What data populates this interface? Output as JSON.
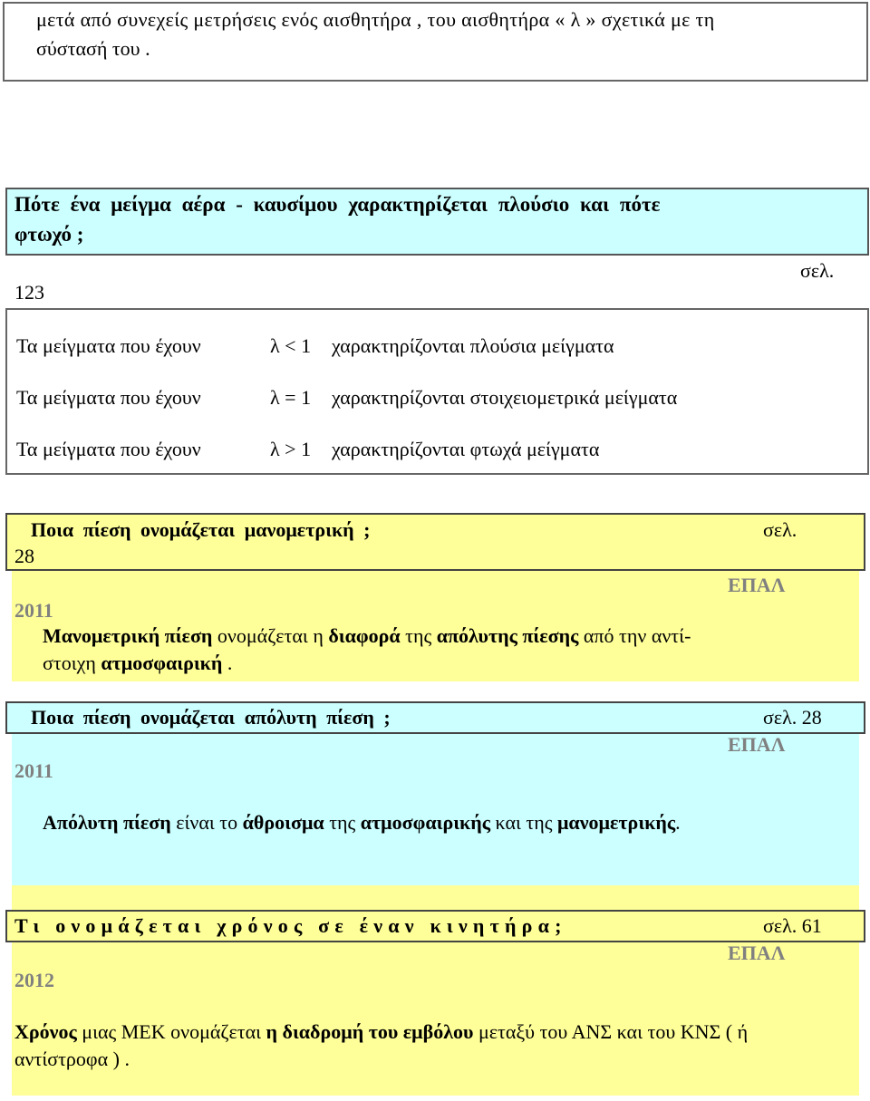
{
  "section_1": {
    "line_1": "μετά από συνεχείς μετρήσεις ενός αισθητήρα , του αισθητήρα « λ » σχετικά με τη",
    "line_2": "σύστασή του ."
  },
  "section_2": {
    "question_line_1": "Πότε ένα μείγμα αέρα - καυσίμου χαρακτηρίζεται πλούσιο και πότε",
    "question_line_2": "φτωχό ;",
    "page_label": "σελ.",
    "page_number": "123"
  },
  "section_3": {
    "rows": [
      {
        "prefix": "Τα μείγματα που έχουν",
        "condition": "λ < 1",
        "suffix": "χαρακτηρίζονται πλούσια μείγματα"
      },
      {
        "prefix": "Τα μείγματα που έχουν",
        "condition": "λ = 1",
        "suffix": "χαρακτηρίζονται στοιχειομετρικά μείγματα"
      },
      {
        "prefix": "Τα μείγματα που έχουν",
        "condition": "λ > 1",
        "suffix": "χαρακτηρίζονται φτωχά μείγματα"
      }
    ]
  },
  "section_4": {
    "question": "Ποια πίεση ονομάζεται μανομετρική ;",
    "page_label": "σελ.",
    "page_number": "28",
    "exam_label": "ΕΠΑΛ",
    "exam_year": "2011",
    "answer": {
      "t1": "Μανομετρική πίεση",
      "t2": " ονομάζεται η ",
      "t3": "διαφορά",
      "t4": " της ",
      "t5": "απόλυτης πίεσης",
      "t6": "  από την αντί-",
      "t7": "στοιχη ",
      "t8": "ατμοσφαιρική",
      "t9": " ."
    }
  },
  "section_5": {
    "question": "Ποια πίεση ονομάζεται απόλυτη πίεση ;",
    "page_ref": "σελ. 28",
    "exam_label": "ΕΠΑΛ",
    "exam_year": "2011",
    "answer": {
      "t1": "Απόλυτη πίεση",
      "t2": " είναι το ",
      "t3": "άθροισμα",
      "t4": " της ",
      "t5": "ατμοσφαιρικής",
      "t6": " και της ",
      "t7": "μανομετρικής",
      "t8": "."
    }
  },
  "section_6": {
    "question": "Τι ονομάζεται χρόνος σε έναν κινητήρα;",
    "page_ref": "σελ. 61",
    "exam_label": "ΕΠΑΛ",
    "exam_year": "2012",
    "answer": {
      "t1": "Χρόνος",
      "t2": " μιας ΜΕΚ ονομάζεται ",
      "t3": "η διαδρομή του εμβόλου",
      "t4": " μεταξύ του ΑΝΣ και του ΚΝΣ ( ή",
      "t5": "αντίστροφα ) ."
    }
  },
  "colors": {
    "cyan_panel": "#ccffff",
    "yellow_panel": "#ffff99",
    "exam_tag": "#808080"
  }
}
